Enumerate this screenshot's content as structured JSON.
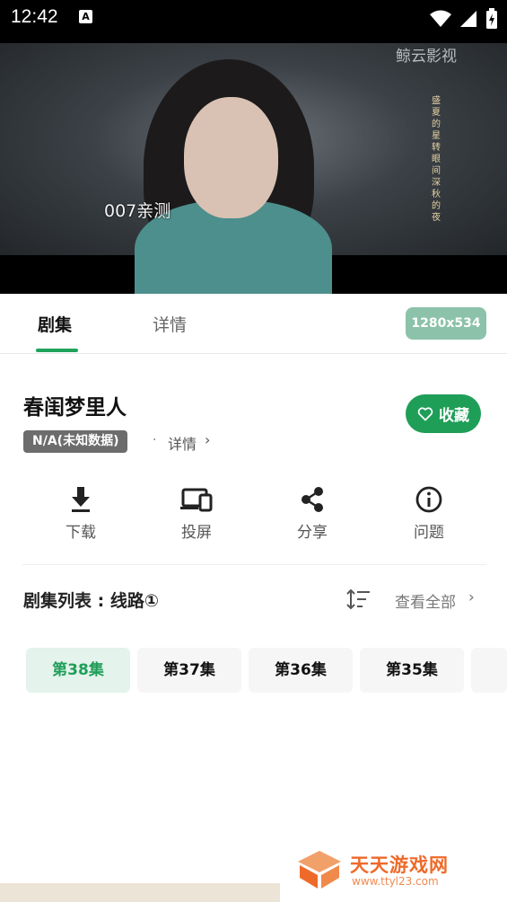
{
  "status_bar": {
    "time": "12:42",
    "notification_icon": "A"
  },
  "video": {
    "watermark": "鲸云影视",
    "caption": "007亲测",
    "poem": "盛夏的星 转眼间 深秋的夜"
  },
  "tabs": [
    {
      "label": "剧集",
      "active": true
    },
    {
      "label": "详情",
      "active": false
    }
  ],
  "resolution_badge": "1280x534",
  "show": {
    "title": "春闺梦里人",
    "rating_tag": "N/A(未知数据)",
    "dot": "·",
    "details_link": "详情",
    "chevron": "›",
    "favorite_label": "收藏"
  },
  "actions": [
    {
      "label": "下载",
      "icon": "download-icon"
    },
    {
      "label": "投屏",
      "icon": "cast-icon"
    },
    {
      "label": "分享",
      "icon": "share-icon"
    },
    {
      "label": "问题",
      "icon": "info-icon"
    }
  ],
  "episode_list": {
    "title": "剧集列表 : 线路①",
    "view_all": "查看全部",
    "chevron": "›",
    "episodes": [
      "第38集",
      "第37集",
      "第36集",
      "第35集"
    ]
  },
  "watermark": {
    "title": "天天游戏网",
    "url": "www.ttyl23.com"
  },
  "colors": {
    "accent": "#1f9e58",
    "badge": "#8cc2aa",
    "tag": "#6c6c6c"
  }
}
